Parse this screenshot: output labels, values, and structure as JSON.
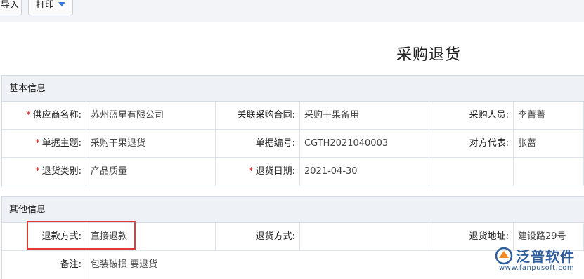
{
  "toolbar": {
    "import_label": "导入",
    "import_visible": "导入",
    "print_label": "打印"
  },
  "page": {
    "title": "采购退货"
  },
  "basic": {
    "header": "基本信息",
    "rows": [
      [
        {
          "label": "供应商名称:",
          "required": true,
          "value": "苏州蓝星有限公司"
        },
        {
          "label": "关联采购合同:",
          "required": false,
          "value": "采购干果备用"
        },
        {
          "label": "采购人员:",
          "required": false,
          "value": "李菁菁"
        }
      ],
      [
        {
          "label": "单据主题:",
          "required": true,
          "value": "采购干果退货"
        },
        {
          "label": "单据编号:",
          "required": false,
          "value": "CGTH2021040003"
        },
        {
          "label": "对方代表:",
          "required": false,
          "value": "张蔷"
        }
      ],
      [
        {
          "label": "退货类别:",
          "required": true,
          "value": "产品质量"
        },
        {
          "label": "退货日期:",
          "required": true,
          "value": "2021-04-30"
        },
        {
          "label": "",
          "required": false,
          "value": ""
        }
      ]
    ]
  },
  "other": {
    "header": "其他信息",
    "rows": [
      [
        {
          "label": "退款方式:",
          "value": "直接退款"
        },
        {
          "label": "退货方式:",
          "value": ""
        },
        {
          "label": "退货地址:",
          "value": "建设路29号"
        }
      ]
    ],
    "note_label": "备注:",
    "note_value": "包装破损 要退货"
  },
  "logo": {
    "text": "泛普软件",
    "url": "www.fanpusoft.com",
    "color": "#2e5d9c"
  },
  "colors": {
    "required": "#e02020",
    "highlight": "#e53935",
    "accent": "#3a7bd5"
  }
}
